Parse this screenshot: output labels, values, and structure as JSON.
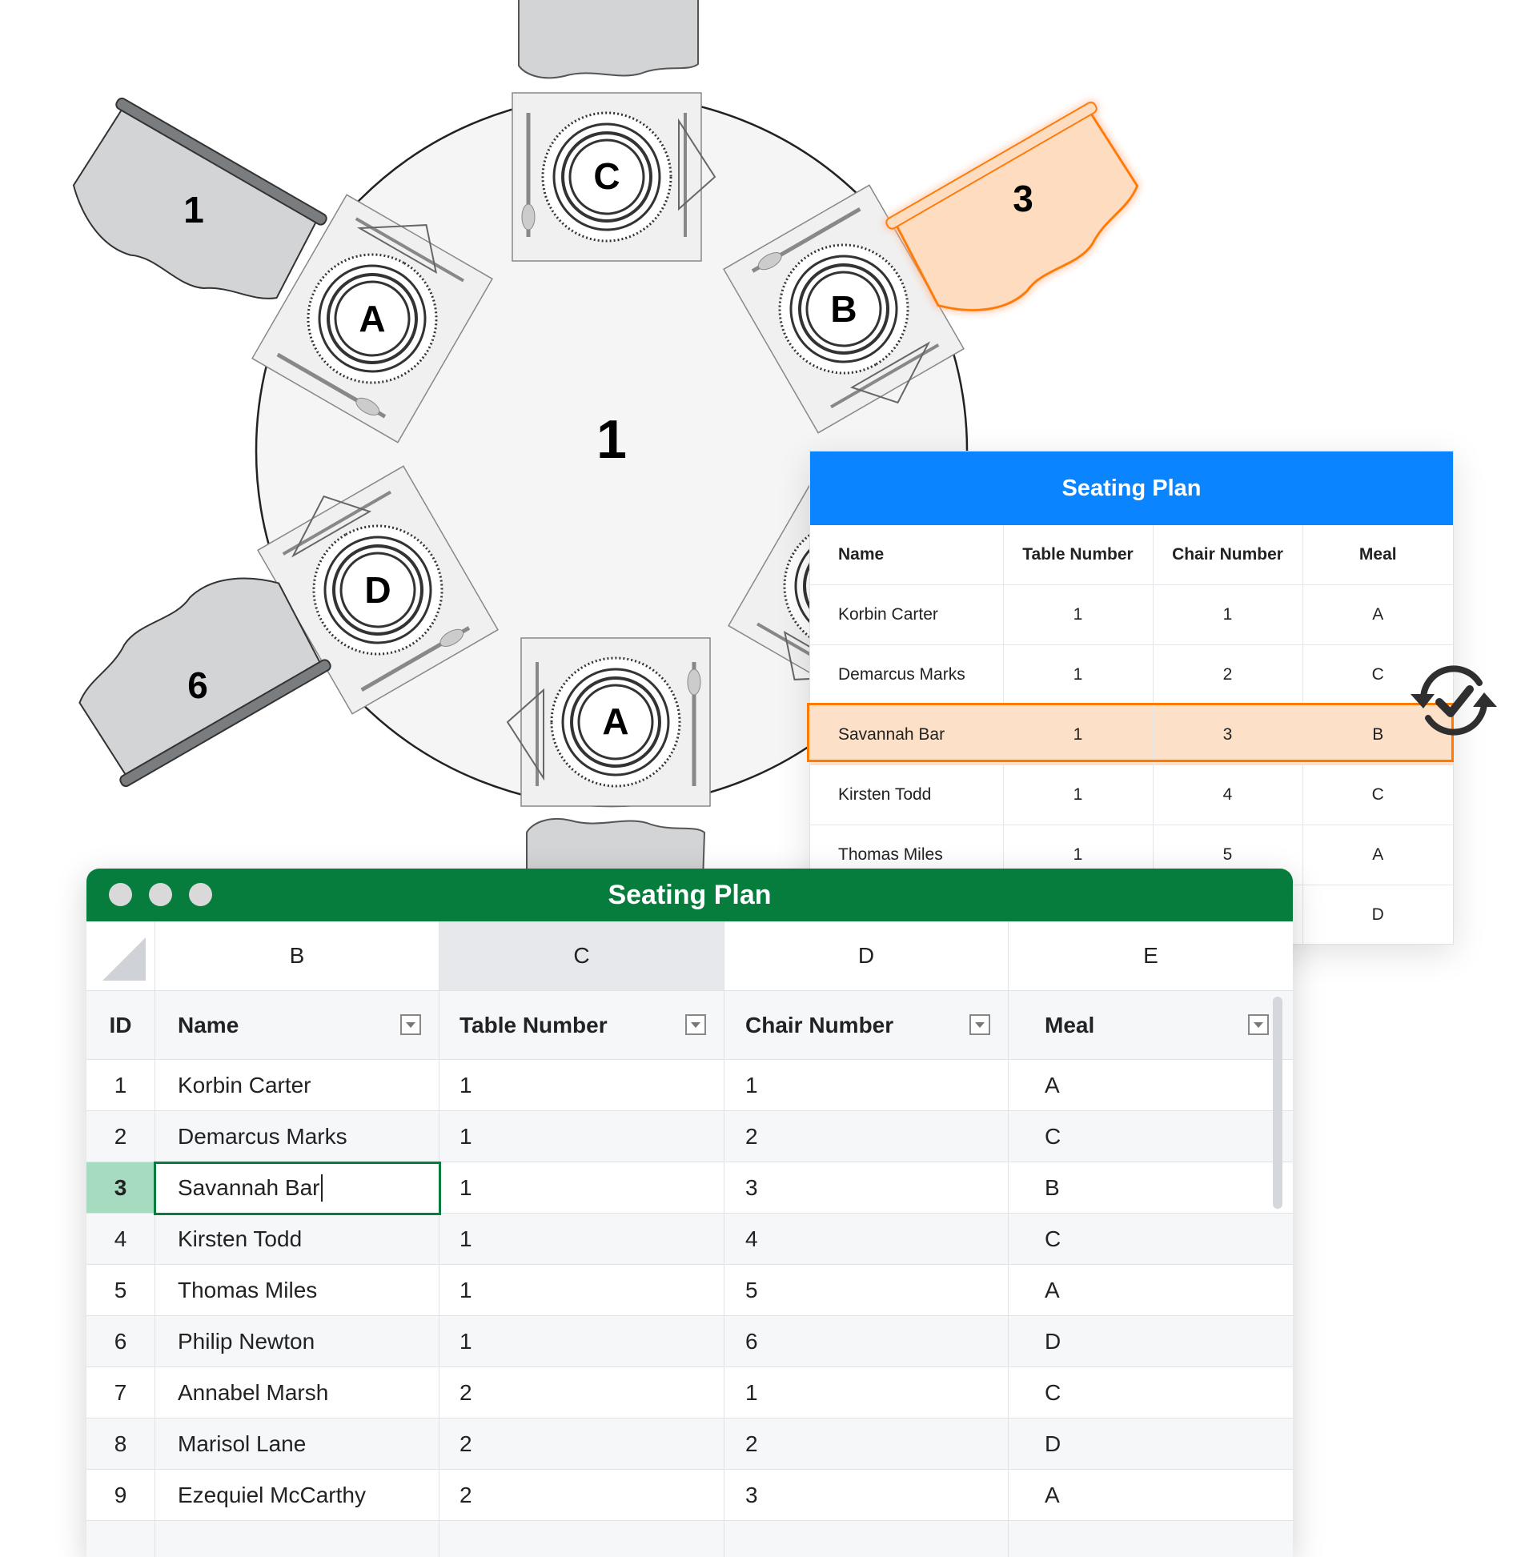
{
  "table_label": "1",
  "chairs": [
    {
      "label": "1",
      "selected": false
    },
    {
      "label": "3",
      "selected": true
    },
    {
      "label": "6",
      "selected": false
    }
  ],
  "place_settings": [
    "C",
    "A",
    "B",
    "D",
    "A"
  ],
  "colors": {
    "panel_header": "#0a84ff",
    "sheet_header": "#067d3c",
    "highlight_orange": "#ff7a00",
    "highlight_fill": "#fde0c8",
    "chair_gray": "#d3d4d6"
  },
  "panel": {
    "title": "Seating Plan",
    "headers": [
      "Name",
      "Table Number",
      "Chair Number",
      "Meal"
    ],
    "rows": [
      [
        "Korbin Carter",
        "1",
        "1",
        "A"
      ],
      [
        "Demarcus Marks",
        "1",
        "2",
        "C"
      ],
      [
        "Savannah Bar",
        "1",
        "3",
        "B"
      ],
      [
        "Kirsten Todd",
        "1",
        "4",
        "C"
      ],
      [
        "Thomas Miles",
        "1",
        "5",
        "A"
      ],
      [
        "",
        "",
        "",
        "D"
      ]
    ],
    "highlighted_row": 2,
    "sync_icon": "sync-check-icon"
  },
  "sheet": {
    "title": "Seating Plan",
    "column_letters": [
      "B",
      "C",
      "D",
      "E"
    ],
    "selected_column": "C",
    "headers": [
      "ID",
      "Name",
      "Table Number",
      "Chair Number",
      "Meal"
    ],
    "rows": [
      [
        "1",
        "Korbin Carter",
        "1",
        "1",
        "A"
      ],
      [
        "2",
        "Demarcus Marks",
        "1",
        "2",
        "C"
      ],
      [
        "3",
        "Savannah Bar",
        "1",
        "3",
        "B"
      ],
      [
        "4",
        "Kirsten Todd",
        "1",
        "4",
        "C"
      ],
      [
        "5",
        "Thomas Miles",
        "1",
        "5",
        "A"
      ],
      [
        "6",
        "Philip Newton",
        "1",
        "6",
        "D"
      ],
      [
        "7",
        "Annabel Marsh",
        "2",
        "1",
        "C"
      ],
      [
        "8",
        "Marisol Lane",
        "2",
        "2",
        "D"
      ],
      [
        "9",
        "Ezequiel McCarthy",
        "2",
        "3",
        "A"
      ]
    ],
    "active_row": 2,
    "active_column": 1
  }
}
